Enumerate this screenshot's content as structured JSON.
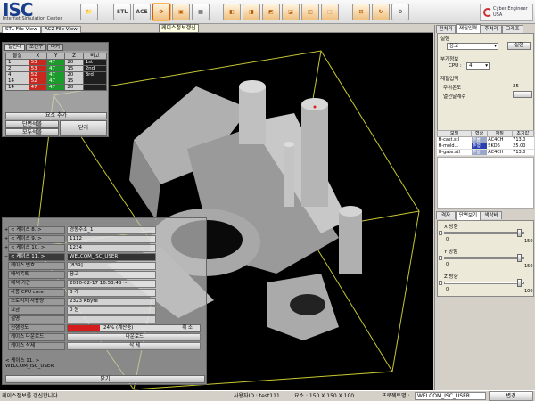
{
  "app": {
    "logo_text": "ISC",
    "logo_sub": "Internet Simulation Center",
    "brand": "Cyber Engineer USA"
  },
  "toolbar": {
    "buttons": [
      "STL",
      "",
      "ACE",
      "",
      "",
      "",
      "",
      "",
      "",
      "",
      "",
      "",
      "",
      ""
    ],
    "tooltip": "케이스정보갱신"
  },
  "view_tabs": [
    "STL File View",
    "AC2 File View"
  ],
  "popup1": {
    "tabs": [
      "열전대",
      "조건구",
      "마커"
    ],
    "headers": [
      "물질",
      "X",
      "Y",
      "Z",
      "비고"
    ],
    "rows": [
      [
        "1",
        "53",
        "47",
        "20",
        "1st"
      ],
      [
        "2",
        "53",
        "47",
        "15",
        "2nd"
      ],
      [
        "4",
        "52",
        "47",
        "20",
        "3rd"
      ],
      [
        "14",
        "52",
        "47",
        "15",
        ""
      ],
      [
        "14",
        "47",
        "47",
        "20",
        ""
      ]
    ],
    "section": "요소 추가",
    "btn_add": "단면석볼",
    "btn_all": "모두석볼",
    "btn_close": "닫기"
  },
  "popup2": {
    "rows": [
      {
        "label": "< 케이스 9. >",
        "value": "1112"
      },
      {
        "label": "< 케이스 10. >",
        "value": "1234"
      },
      {
        "label": "< 케이스 11. >",
        "value": "WELCOM_ISC_USER"
      },
      {
        "label": "케이스 번호",
        "value": "[839]"
      },
      {
        "label": "해석목록",
        "value": "응고"
      },
      {
        "label": "해석 기간",
        "value": "2010-02-17 16:53:43 ~"
      },
      {
        "label": "사용 CPU core",
        "value": "8 개"
      },
      {
        "label": "스토리지 사용량",
        "value": "2323 KByte"
      },
      {
        "label": "요금",
        "value": "0 원"
      },
      {
        "label": "설명",
        "value": ""
      },
      {
        "label": "진행정도",
        "value": "24% (계산중)"
      },
      {
        "label": "케이스 다운로드",
        "value": "다운로드"
      },
      {
        "label": "케이스 삭제",
        "value": "삭 제"
      }
    ],
    "top_label": "< 케이스 8. >",
    "top_value": "경동주조_1",
    "progress": 0.24,
    "progress_side": "취 소",
    "footer_title": "< 케이스 11. >",
    "footer_user": "WELCOM_ISC_USER",
    "close": "닫기"
  },
  "right_panel": {
    "tabs": [
      "전처리",
      "재질입력",
      "후처리",
      "그래프"
    ],
    "analysis_label": "실행",
    "analysis_value": "응고",
    "run_button": "실행",
    "extra_label": "부가정보",
    "cpu_label": "CPU :",
    "cpu_value": "4",
    "material_section": "재질입력",
    "pour_temp_label": "주위온도",
    "pour_temp_value": "25",
    "heat_label": "열전달계수",
    "heat_btn": "...",
    "mat_headers": [
      "모델",
      "형상",
      "재질",
      "초기값"
    ],
    "mat_rows": [
      [
        "H-cast.stl",
        "주물",
        "AC4CH",
        "713.0"
      ],
      [
        "H-mold...",
        "주형",
        "SKD6",
        "25.00"
      ],
      [
        "H-gate.stl",
        "주물",
        "AC4CH",
        "713.0"
      ]
    ],
    "lower_tabs": [
      "격자",
      "단면보기",
      "색상바"
    ],
    "axes": [
      {
        "label": "X 방향",
        "max": "150"
      },
      {
        "label": "Y 방향",
        "max": "150"
      },
      {
        "label": "Z 방향",
        "max": "100"
      }
    ],
    "axis_zero": "0"
  },
  "status": {
    "left": "케이스정보를 갱신합니다.",
    "user_label": "사용자ID : test111",
    "elements": "요소 : 150 X 150 X 100",
    "project_label": "프로젝트명 :",
    "project_value": "WELCOM_ISC_USER",
    "change": "변경"
  }
}
